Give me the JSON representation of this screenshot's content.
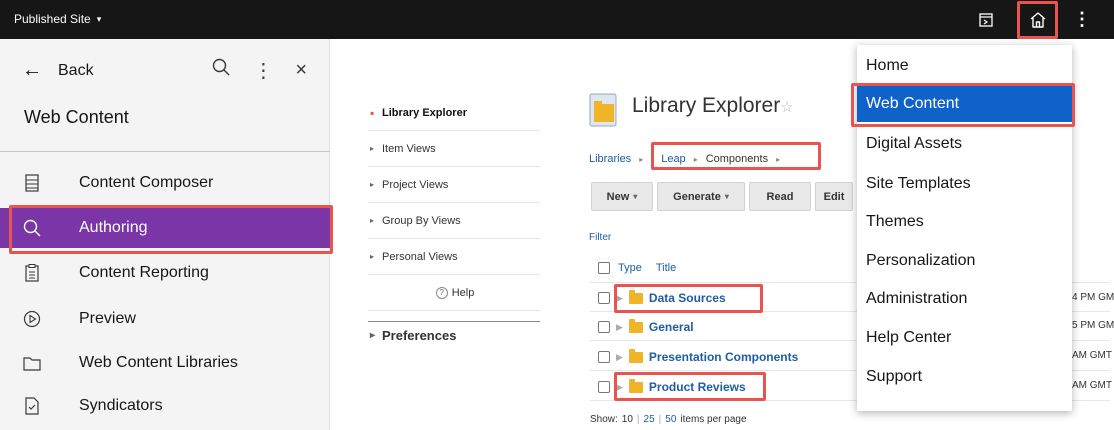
{
  "topbar": {
    "site_label": "Published Site",
    "site_caret": "▾",
    "icons": {
      "dashboard": "dashboard-icon",
      "home": "home-icon",
      "more": "overflow-menu-icon"
    },
    "more_glyph": "⋮"
  },
  "sidebar": {
    "back_arrow": "←",
    "back_label": "Back",
    "more_glyph": "⋮",
    "close_glyph": "×",
    "title": "Web Content",
    "items": [
      {
        "label": "Content Composer",
        "icon": "document-list-icon",
        "active": false
      },
      {
        "label": "Authoring",
        "icon": "search-icon",
        "active": true
      },
      {
        "label": "Content Reporting",
        "icon": "clipboard-icon",
        "active": false
      },
      {
        "label": "Preview",
        "icon": "play-circle-icon",
        "active": false
      },
      {
        "label": "Web Content Libraries",
        "icon": "folder-icon",
        "active": false
      },
      {
        "label": "Syndicators",
        "icon": "document-check-icon",
        "active": false
      }
    ]
  },
  "midnav": {
    "items": [
      {
        "label": "Library Explorer",
        "bullet": "▪",
        "active": true
      },
      {
        "label": "Item Views",
        "bullet": "▸",
        "active": false
      },
      {
        "label": "Project Views",
        "bullet": "▸",
        "active": false
      },
      {
        "label": "Group By Views",
        "bullet": "▸",
        "active": false
      },
      {
        "label": "Personal Views",
        "bullet": "▸",
        "active": false
      }
    ],
    "help_label": "Help",
    "help_glyph": "?",
    "preferences_label": "Preferences",
    "preferences_glyph": "▸"
  },
  "library": {
    "title": "Library Explorer",
    "star": "☆",
    "breadcrumbs": [
      "Libraries",
      "Leap",
      "Components"
    ],
    "crumb_sep": "▸",
    "toolbar": [
      {
        "label": "New",
        "dropdown": true
      },
      {
        "label": "Generate",
        "dropdown": true
      },
      {
        "label": "Read",
        "dropdown": false
      },
      {
        "label": "Edit",
        "dropdown": false
      }
    ],
    "filter_label": "Filter",
    "columns": {
      "type": "Type",
      "title": "Title"
    },
    "rows": [
      {
        "title": "Data Sources",
        "time": "4 PM GM"
      },
      {
        "title": "General",
        "time": "5 PM GM"
      },
      {
        "title": "Presentation Components",
        "time": "AM GMT"
      },
      {
        "title": "Product Reviews",
        "time": "AM GMT"
      }
    ],
    "tri": "▶",
    "pager": {
      "show_label": "Show:",
      "options": [
        "10",
        "25",
        "50"
      ],
      "suffix": "items per page"
    }
  },
  "dropdown": {
    "items": [
      {
        "label": "Home",
        "selected": false
      },
      {
        "label": "Web Content",
        "selected": true
      },
      {
        "label": "Digital Assets",
        "selected": false
      },
      {
        "label": "Site Templates",
        "selected": false
      },
      {
        "label": "Themes",
        "selected": false
      },
      {
        "label": "Personalization",
        "selected": false
      },
      {
        "label": "Administration",
        "selected": false
      },
      {
        "label": "Help Center",
        "selected": false
      },
      {
        "label": "Support",
        "selected": false
      }
    ]
  },
  "colors": {
    "topbar_bg": "#161616",
    "sidebar_active": "#7a35a7",
    "menu_selected": "#0f62c9",
    "highlight_box": "#e8544f",
    "link": "#1f5da3",
    "folder": "#f0b429"
  }
}
